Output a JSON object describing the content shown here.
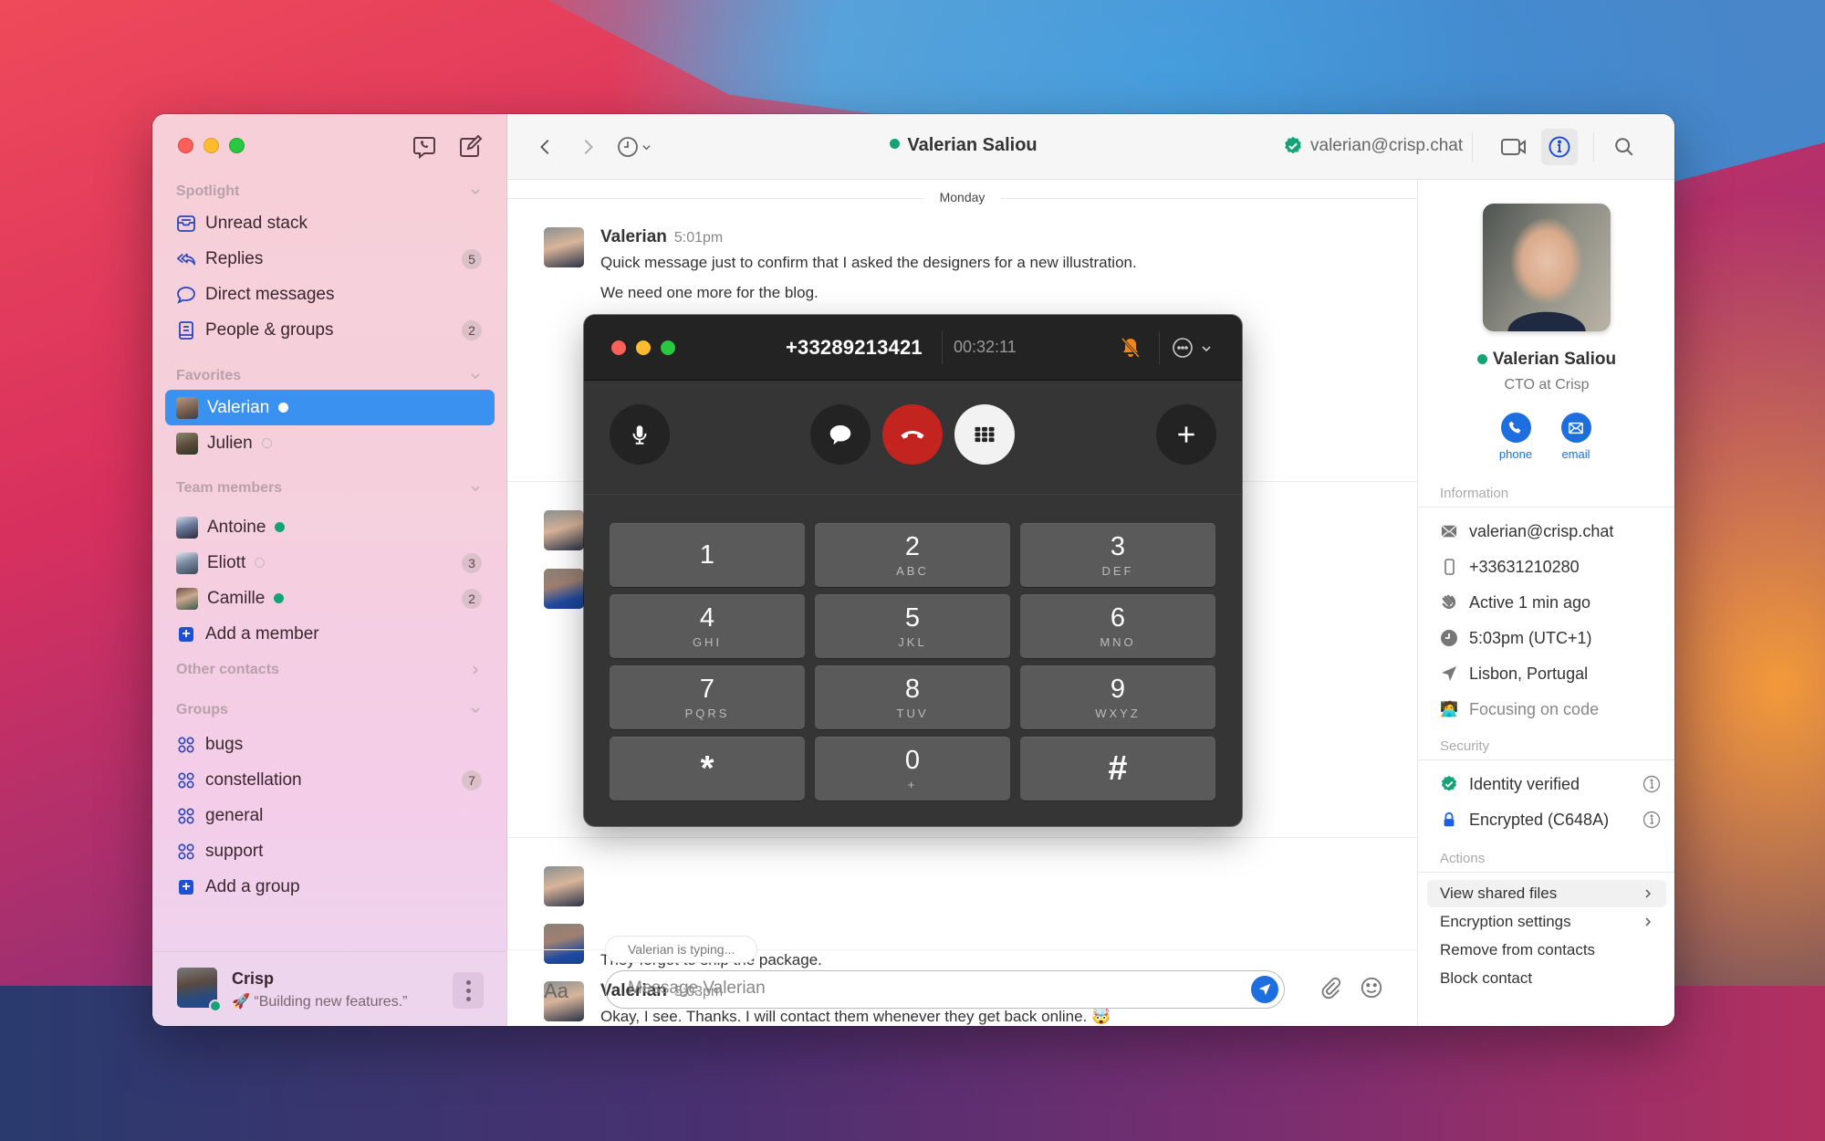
{
  "colors": {
    "accent": "#3a91f0",
    "brand_blue": "#1d6fe0",
    "online": "#14a374",
    "hangup_red": "#c42420",
    "icon_blue": "#2a47b8"
  },
  "sidebar": {
    "top_icons": [
      "phone-chat-icon",
      "compose-icon"
    ],
    "spotlight": {
      "title": "Spotlight",
      "items": [
        {
          "label": "Unread stack",
          "icon": "inbox-icon",
          "badge": null
        },
        {
          "label": "Replies",
          "icon": "reply-all-icon",
          "badge": "5"
        },
        {
          "label": "Direct messages",
          "icon": "chat-bubble-icon",
          "badge": null
        },
        {
          "label": "People & groups",
          "icon": "address-book-icon",
          "badge": "2"
        }
      ]
    },
    "favorites": {
      "title": "Favorites",
      "items": [
        {
          "label": "Valerian",
          "status": "online",
          "active": true
        },
        {
          "label": "Julien",
          "status": "offline"
        }
      ]
    },
    "team": {
      "title": "Team members",
      "items": [
        {
          "label": "Antoine",
          "status": "online",
          "badge": null
        },
        {
          "label": "Eliott",
          "status": "offline",
          "badge": "3"
        },
        {
          "label": "Camille",
          "status": "online",
          "badge": "2"
        }
      ],
      "add_label": "Add a member"
    },
    "other_contacts": {
      "title": "Other contacts"
    },
    "groups": {
      "title": "Groups",
      "items": [
        {
          "label": "bugs",
          "badge": null
        },
        {
          "label": "constellation",
          "badge": "7"
        },
        {
          "label": "general",
          "badge": null
        },
        {
          "label": "support",
          "badge": null
        }
      ],
      "add_label": "Add a group"
    },
    "footer": {
      "name": "Crisp",
      "status_emoji": "🚀",
      "status_text": "“Building new features.”"
    }
  },
  "header": {
    "contact_name": "Valerian Saliou",
    "contact_status": "online",
    "email": "valerian@crisp.chat"
  },
  "chat": {
    "day_label": "Monday",
    "messages": [
      {
        "author": "Valerian",
        "time": "5:01pm",
        "lines": [
          "Quick message just to confirm that I asked the designers for a new illustration.",
          "We need one more for the blog."
        ]
      },
      {
        "author": "",
        "time": "",
        "lines": [
          "They forgot to ship the package."
        ]
      },
      {
        "author": "Valerian",
        "time": "5:03pm",
        "lines": [
          "Okay, I see. Thanks. I will contact them whenever they get back online. 🤯"
        ]
      }
    ],
    "typing_indicator": "Valerian is typing...",
    "composer": {
      "format_label": "Aa",
      "placeholder": "Message Valerian",
      "value": ""
    }
  },
  "profile": {
    "name": "Valerian Saliou",
    "role": "CTO at Crisp",
    "status": "online",
    "actions": [
      {
        "label": "phone",
        "icon": "phone-icon"
      },
      {
        "label": "email",
        "icon": "envelope-icon"
      }
    ],
    "information": {
      "title": "Information",
      "rows": [
        {
          "icon": "envelope-icon",
          "text": "valerian@crisp.chat"
        },
        {
          "icon": "mobile-phone-icon",
          "text": "+33631210280"
        },
        {
          "icon": "waving-hand-icon",
          "text": "Active 1 min ago"
        },
        {
          "icon": "clock-icon",
          "text": "5:03pm (UTC+1)"
        },
        {
          "icon": "location-arrow-icon",
          "text": "Lisbon, Portugal"
        },
        {
          "icon": "technologist-emoji",
          "emoji": "🧑‍💻",
          "text": "Focusing on code"
        }
      ]
    },
    "security": {
      "title": "Security",
      "rows": [
        {
          "icon": "verified-badge-icon",
          "text": "Identity verified"
        },
        {
          "icon": "lock-icon",
          "text": "Encrypted (C648A)"
        }
      ]
    },
    "actions_section": {
      "title": "Actions",
      "items": [
        {
          "label": "View shared files",
          "chevron": true,
          "highlighted": true
        },
        {
          "label": "Encryption settings",
          "chevron": true
        },
        {
          "label": "Remove from contacts",
          "chevron": false
        },
        {
          "label": "Block contact",
          "chevron": false
        }
      ]
    }
  },
  "call": {
    "number": "+33289213421",
    "duration": "00:32:11",
    "controls": [
      "microphone-icon",
      "message-bubble-icon",
      "hang-up-icon",
      "keypad-icon",
      "add-icon"
    ],
    "keys": [
      {
        "digit": "1",
        "letters": ""
      },
      {
        "digit": "2",
        "letters": "ABC"
      },
      {
        "digit": "3",
        "letters": "DEF"
      },
      {
        "digit": "4",
        "letters": "GHI"
      },
      {
        "digit": "5",
        "letters": "JKL"
      },
      {
        "digit": "6",
        "letters": "MNO"
      },
      {
        "digit": "7",
        "letters": "PQRS"
      },
      {
        "digit": "8",
        "letters": "TUV"
      },
      {
        "digit": "9",
        "letters": "WXYZ"
      },
      {
        "digit": "*",
        "letters": ""
      },
      {
        "digit": "0",
        "letters": "+"
      },
      {
        "digit": "#",
        "letters": ""
      }
    ]
  }
}
